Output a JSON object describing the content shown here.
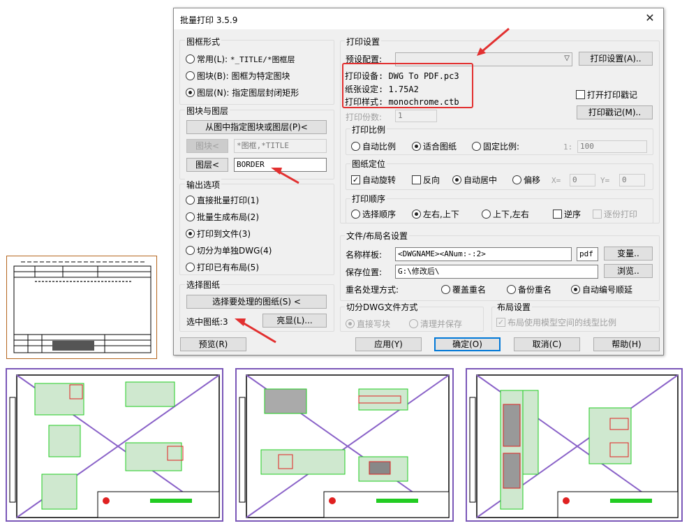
{
  "dialog": {
    "title": "批量打印 3.5.9",
    "close_glyph": "✕"
  },
  "frame_format": {
    "label": "图框形式",
    "options": [
      {
        "label": "常用(L):",
        "value": "*_TITLE/*图框层",
        "selected": false
      },
      {
        "label": "图块(B):",
        "value": "图框为特定图块",
        "selected": false
      },
      {
        "label": "图层(N):",
        "value": "指定图层封闭矩形",
        "selected": true
      }
    ]
  },
  "block_layer": {
    "label": "图块与图层",
    "pick_button": "从图中指定图块或图层(P)<",
    "block_button": "图块<",
    "block_value": "*图框,*TITLE",
    "layer_button": "图层<",
    "layer_value": "BORDER"
  },
  "output": {
    "label": "输出选项",
    "options": [
      {
        "label": "直接批量打印(1)",
        "selected": false
      },
      {
        "label": "批量生成布局(2)",
        "selected": false
      },
      {
        "label": "打印到文件(3)",
        "selected": true
      },
      {
        "label": "切分为单独DWG(4)",
        "selected": false
      },
      {
        "label": "打印已有布局(5)",
        "selected": false
      }
    ]
  },
  "select": {
    "label": "选择图纸",
    "select_button": "选择要处理的图纸(S) <",
    "count_text": "选中图纸:3",
    "highlight_button": "亮显(L)..."
  },
  "preview_button": "预览(R)",
  "print_settings": {
    "label": "打印设置",
    "preset_label": "预设配置:",
    "preset_value": "",
    "settings_button": "打印设置(A)..",
    "device": "打印设备: DWG To PDF.pc3",
    "paper": "纸张设定: 1.75A2",
    "style": "打印样式: monochrome.ctb",
    "open_stamp_label": "打开打印戳记",
    "stamp_button": "打印戳记(M)..",
    "copies_label": "打印份数:",
    "copies_value": "1"
  },
  "scale": {
    "label": "打印比例",
    "options": [
      {
        "label": "自动比例",
        "selected": false
      },
      {
        "label": "适合图纸",
        "selected": true
      },
      {
        "label": "固定比例:",
        "selected": false
      }
    ],
    "ratio_label": "1:",
    "ratio_value": "100"
  },
  "position": {
    "label": "图纸定位",
    "auto_rotate": "自动旋转",
    "auto_rotate_checked": true,
    "reverse": "反向",
    "reverse_checked": false,
    "options": [
      {
        "label": "自动居中",
        "selected": true
      },
      {
        "label": "偏移",
        "selected": false
      }
    ],
    "x_label": "X=",
    "x_value": "0",
    "y_label": "Y=",
    "y_value": "0"
  },
  "order": {
    "label": "打印顺序",
    "options": [
      {
        "label": "选择顺序",
        "selected": false
      },
      {
        "label": "左右,上下",
        "selected": true
      },
      {
        "label": "上下,左右",
        "selected": false
      }
    ],
    "reverse": "逆序",
    "collate": "逐份打印"
  },
  "file_naming": {
    "label": "文件/布局名设置",
    "template_label": "名称样板:",
    "template_value": "<DWGNAME><ANum:-:2>",
    "ext_value": "pdf",
    "variables_button": "变量..",
    "location_label": "保存位置:",
    "location_value": "G:\\修改后\\",
    "browse_button": "浏览..",
    "rename_label": "重名处理方式:",
    "rename_options": [
      {
        "label": "覆盖重名",
        "selected": false
      },
      {
        "label": "备份重名",
        "selected": false
      },
      {
        "label": "自动编号顺延",
        "selected": true
      }
    ]
  },
  "split": {
    "label": "切分DWG文件方式",
    "options": [
      {
        "label": "直接写块",
        "selected": true
      },
      {
        "label": "清理并保存",
        "selected": false
      }
    ]
  },
  "layout": {
    "label": "布局设置",
    "option": "布局使用模型空间的线型比例",
    "checked": true
  },
  "buttons": {
    "apply": "应用(Y)",
    "ok": "确定(O)",
    "cancel": "取消(C)",
    "help": "帮助(H)"
  },
  "colors": {
    "annotation_red": "#e23030",
    "drawing_frame": "#7a57b8",
    "cad_green": "#22cc22",
    "cad_red": "#e02020"
  }
}
